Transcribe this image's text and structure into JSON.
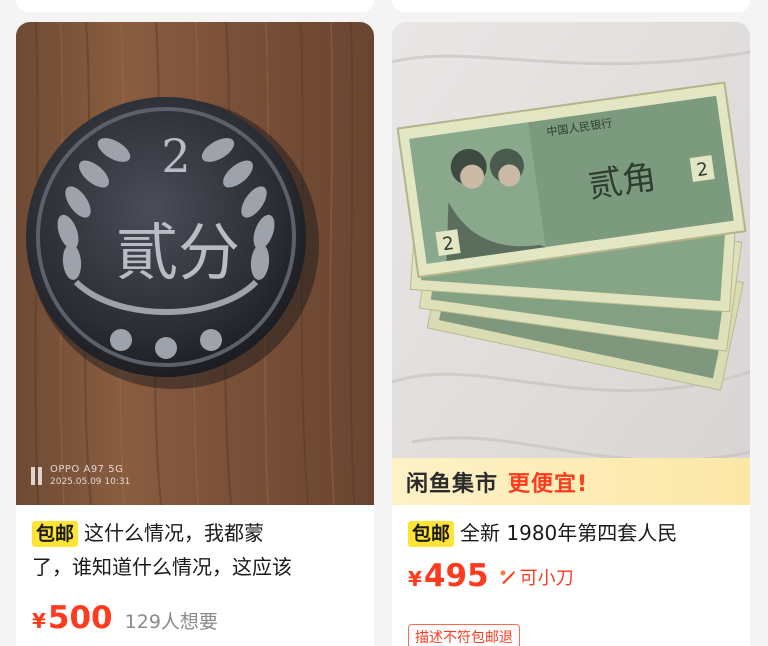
{
  "feed": {
    "items": [
      {
        "image_subject": "coin",
        "coin_denomination": "2",
        "coin_text": "貳分",
        "watermark_model": "OPPO A97 5G",
        "watermark_date": "2025.05.09 10:31",
        "tag": "包邮",
        "title_line1": "这什么情况，我都蒙",
        "title_line2": "了，谁知道什么情况，这应该",
        "currency": "¥",
        "price": "500",
        "wants": "129人想要"
      },
      {
        "image_subject": "banknotes",
        "note_text": "贰角",
        "note_header": "中国人民银行",
        "banner_brand": "闲鱼集市",
        "banner_accent": "更便宜!",
        "tag": "包邮",
        "title_line1": "全新 1980年第四套人民",
        "currency": "¥",
        "price": "495",
        "haggle": "可小刀",
        "promo": "描述不符包邮退"
      }
    ]
  },
  "colors": {
    "accent": "#ff3b1f",
    "tag_bg": "#ffe433",
    "banner_bg": "#fce7a6"
  }
}
